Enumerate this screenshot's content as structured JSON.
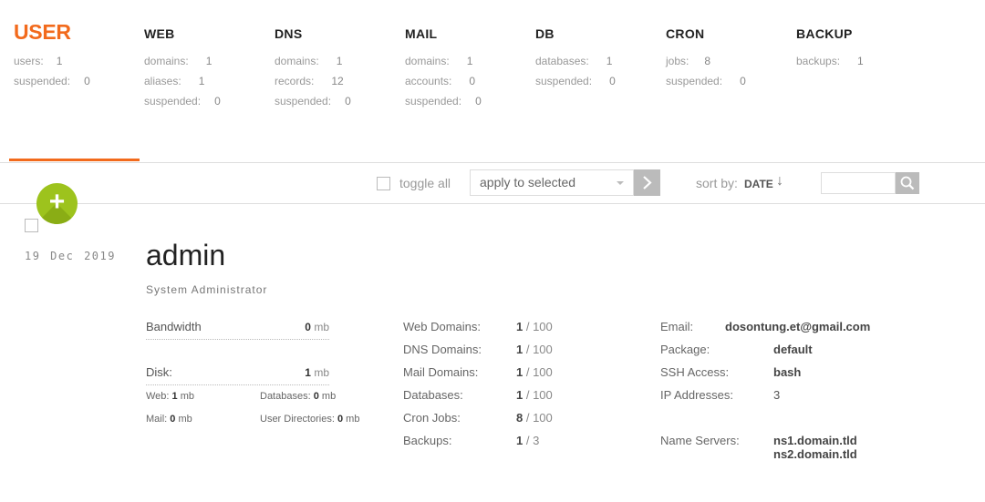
{
  "stats": {
    "user": {
      "title": "USER",
      "rows": [
        [
          "users:",
          "1"
        ],
        [
          "suspended:",
          "0"
        ]
      ]
    },
    "web": {
      "title": "WEB",
      "rows": [
        [
          "domains:",
          "1"
        ],
        [
          "aliases:",
          "1"
        ],
        [
          "suspended:",
          "0"
        ]
      ]
    },
    "dns": {
      "title": "DNS",
      "rows": [
        [
          "domains:",
          "1"
        ],
        [
          "records:",
          "12"
        ],
        [
          "suspended:",
          "0"
        ]
      ]
    },
    "mail": {
      "title": "MAIL",
      "rows": [
        [
          "domains:",
          "1"
        ],
        [
          "accounts:",
          "0"
        ],
        [
          "suspended:",
          "0"
        ]
      ]
    },
    "db": {
      "title": "DB",
      "rows": [
        [
          "databases:",
          "1"
        ],
        [
          "suspended:",
          "0"
        ]
      ]
    },
    "cron": {
      "title": "CRON",
      "rows": [
        [
          "jobs:",
          "8"
        ],
        [
          "suspended:",
          "0"
        ]
      ]
    },
    "backup": {
      "title": "BACKUP",
      "rows": [
        [
          "backups:",
          "1"
        ]
      ]
    }
  },
  "toolbar": {
    "toggle_all": "toggle all",
    "apply_selected": "apply to selected",
    "sort_label": "sort by:",
    "sort_value": "DATE",
    "sort_arrow": "↓"
  },
  "add_button": "+",
  "user": {
    "date": "19 Dec 2019",
    "name": "admin",
    "role": "System Administrator",
    "bandwidth_label": "Bandwidth",
    "bandwidth_value": "0",
    "bandwidth_unit": " mb",
    "disk_label": "Disk:",
    "disk_value": "1",
    "disk_unit": " mb",
    "disk_breakdown": {
      "web_label": "Web:",
      "web_value": "1",
      "web_unit": " mb",
      "databases_label": "Databases:",
      "databases_value": "0",
      "databases_unit": " mb",
      "mail_label": "Mail:",
      "mail_value": "0",
      "mail_unit": " mb",
      "userdirs_label": "User Directories:",
      "userdirs_value": "0",
      "userdirs_unit": " mb"
    },
    "limits": [
      {
        "label": "Web Domains:",
        "used": "1",
        "limit": " / 100"
      },
      {
        "label": "DNS Domains:",
        "used": "1",
        "limit": " / 100"
      },
      {
        "label": "Mail Domains:",
        "used": "1",
        "limit": " / 100"
      },
      {
        "label": "Databases:",
        "used": "1",
        "limit": " / 100"
      },
      {
        "label": "Cron Jobs:",
        "used": "8",
        "limit": " / 100"
      },
      {
        "label": "Backups:",
        "used": "1",
        "limit": " / 3"
      }
    ],
    "details": {
      "email_label": "Email:",
      "email": "dosontung.et@gmail.com",
      "package_label": "Package:",
      "package": "default",
      "ssh_label": "SSH Access:",
      "ssh": "bash",
      "ip_label": "IP Addresses:",
      "ip": "3",
      "ns_label": "Name Servers:",
      "ns1": "ns1.domain.tld",
      "ns2": "ns2.domain.tld"
    }
  },
  "colors": {
    "accent": "#f26a1c",
    "add_button": "#9dc31d"
  }
}
